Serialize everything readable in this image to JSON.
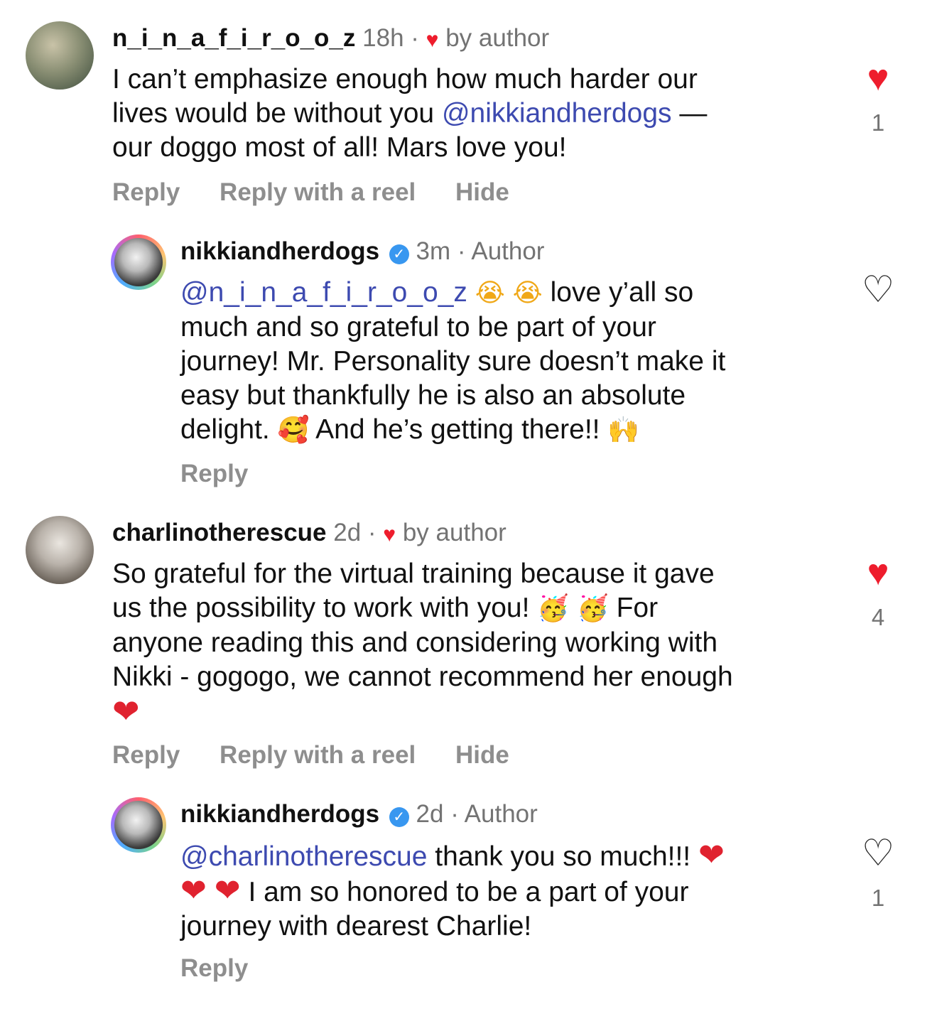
{
  "comments": [
    {
      "username": "n_i_n_a_f_i_r_o_o_z",
      "time": "18h",
      "dot": "·",
      "liked_by_author": "by author",
      "lines": [
        [
          "I can’t emphasize enough how much harder our"
        ],
        [
          "lives would be without you ",
          "@nikkiandherdogs",
          " —"
        ],
        [
          "our doggo most of all! Mars love you!"
        ]
      ],
      "actions": [
        "Reply",
        "Reply with a reel",
        "Hide"
      ],
      "like_count": "1",
      "liked": true
    },
    {
      "username": "nikkiandherdogs",
      "time": "3m",
      "dot": "·",
      "role": "Author",
      "mention": "@n_i_n_a_f_i_r_o_o_z",
      "lines": [
        "love y’all so",
        "much and so grateful to be part of your",
        "journey! Mr. Personality sure doesn’t make it",
        "easy but thankfully he is also an absolute",
        "delight.",
        "And he’s getting there!!"
      ],
      "emoji_cry": "😭",
      "emoji_hearts_face": "🥰",
      "emoji_raised_hands": "🙌",
      "actions": [
        "Reply"
      ],
      "like_count": "",
      "liked": false
    },
    {
      "username": "charlinotherescue",
      "time": "2d",
      "dot": "·",
      "liked_by_author": "by author",
      "lines": [
        "So grateful for the virtual training because it gave",
        "us the possibility to work with you!",
        "For",
        "anyone reading this and considering working with",
        "Nikki - gogogo, we cannot recommend her enough"
      ],
      "emoji_party": "🥳",
      "emoji_heart": "❤",
      "actions": [
        "Reply",
        "Reply with a reel",
        "Hide"
      ],
      "like_count": "4",
      "liked": true
    },
    {
      "username": "nikkiandherdogs",
      "time": "2d",
      "dot": "·",
      "role": "Author",
      "mention": "@charlinotherescue",
      "lines": [
        " thank you so much!!!",
        "I am so honored to be a part of your",
        "journey with dearest Charlie!"
      ],
      "emoji_heart": "❤",
      "actions": [
        "Reply"
      ],
      "like_count": "1",
      "liked": false
    }
  ],
  "icons": {
    "heart_filled": "♥",
    "heart_outline": "♡",
    "verified_check": "✓"
  },
  "colors": {
    "mention": "#3d4ab0",
    "like_red": "#ee1d2d",
    "muted": "#737373",
    "action_gray": "#8e8e8e",
    "verified_blue": "#3897f0"
  }
}
